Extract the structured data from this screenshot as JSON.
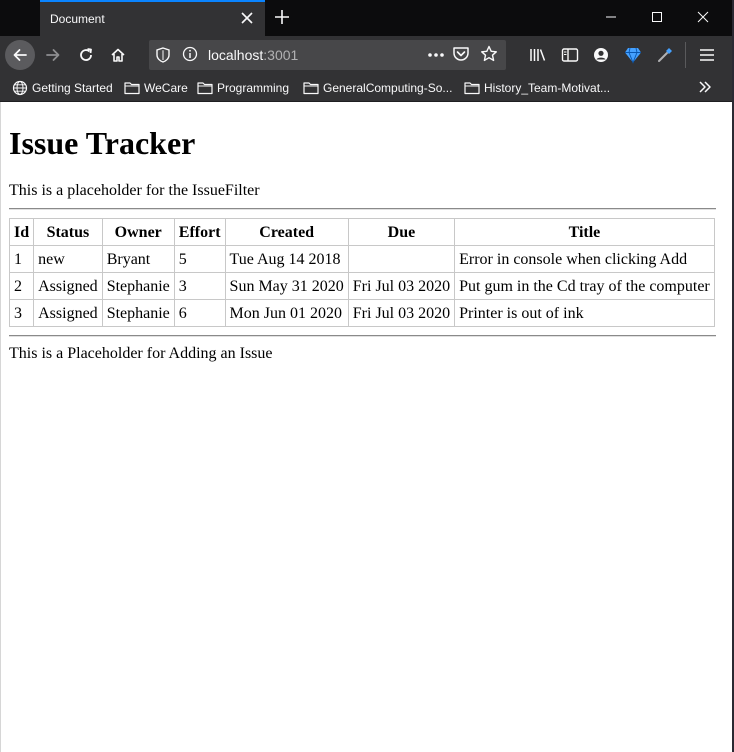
{
  "browser": {
    "tab_title": "Document",
    "url_host": "localhost",
    "url_port": ":3001",
    "bookmarks": [
      {
        "label": "Getting Started",
        "icon": "globe-icon"
      },
      {
        "label": "WeCare",
        "icon": "folder-icon"
      },
      {
        "label": "Programming",
        "icon": "folder-icon"
      },
      {
        "label": "GeneralComputing-So...",
        "icon": "folder-icon"
      },
      {
        "label": "History_Team-Motivat...",
        "icon": "folder-icon"
      }
    ],
    "colors": {
      "tab_strip": "#0c0c0d",
      "toolbar": "#323234",
      "active_tab_accent": "#0a84ff",
      "urlbar": "#474749"
    }
  },
  "page": {
    "title": "Issue Tracker",
    "filter_placeholder": "This is a placeholder for the IssueFilter",
    "add_placeholder": "This is a Placeholder for Adding an Issue",
    "table": {
      "headers": [
        "Id",
        "Status",
        "Owner",
        "Effort",
        "Created",
        "Due",
        "Title"
      ],
      "rows": [
        [
          "1",
          "new",
          "Bryant",
          "5",
          "Tue Aug 14 2018",
          "",
          "Error in console when clicking Add"
        ],
        [
          "2",
          "Assigned",
          "Stephanie",
          "3",
          "Sun May 31 2020",
          "Fri Jul 03 2020",
          "Put gum in the Cd tray of the computer"
        ],
        [
          "3",
          "Assigned",
          "Stephanie",
          "6",
          "Mon Jun 01 2020",
          "Fri Jul 03 2020",
          "Printer is out of ink"
        ]
      ]
    }
  }
}
